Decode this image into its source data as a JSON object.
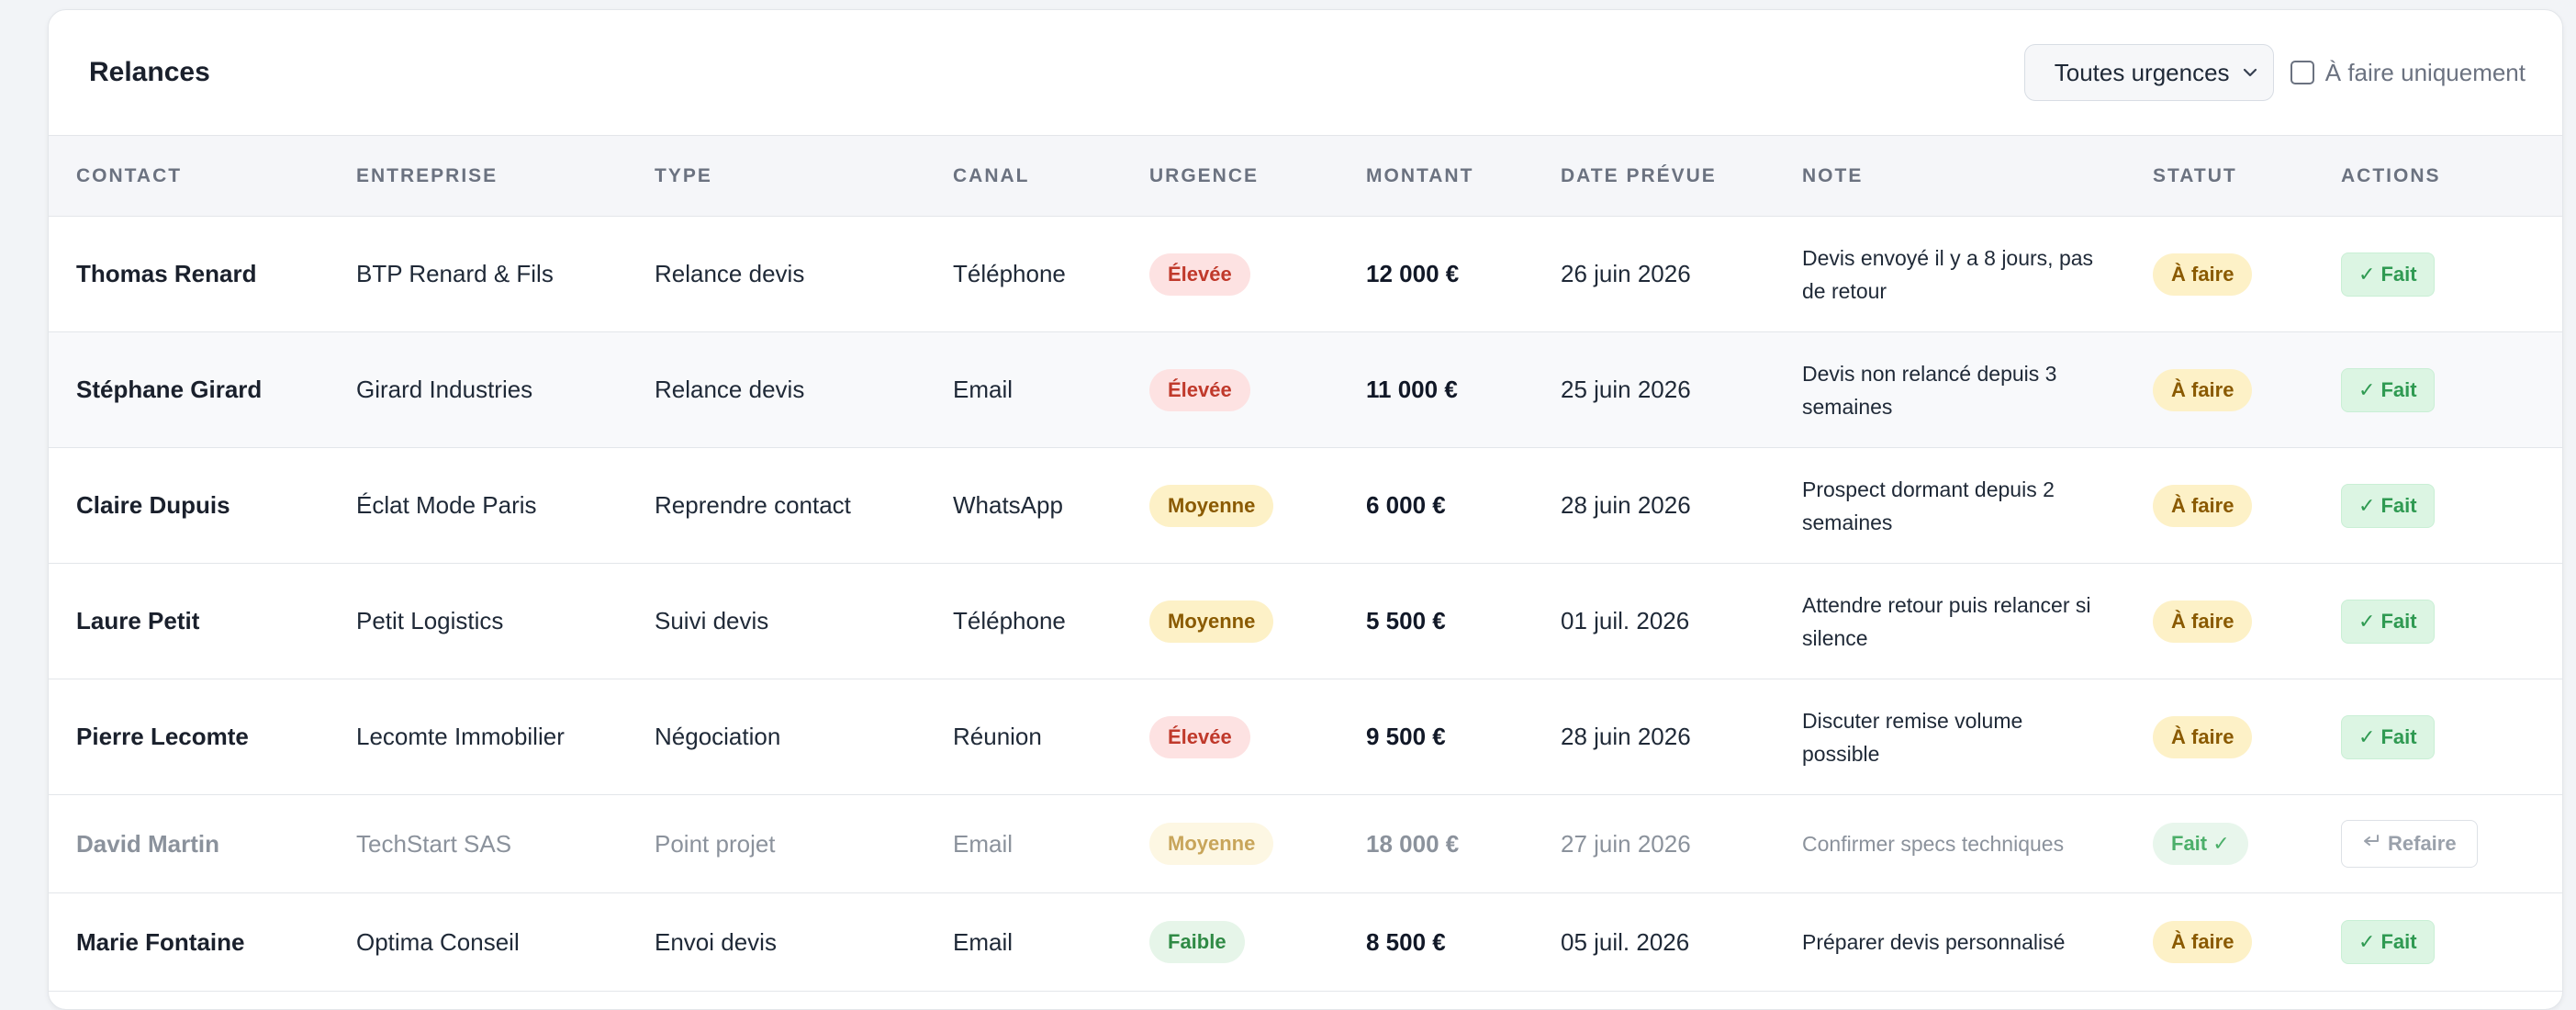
{
  "header": {
    "title": "Relances",
    "urgency_filter": "Toutes urgences",
    "todo_only_label": "À faire uniquement"
  },
  "columns": [
    "Contact",
    "Entreprise",
    "Type",
    "Canal",
    "Urgence",
    "Montant",
    "Date prévue",
    "Note",
    "Statut",
    "Actions"
  ],
  "rows": [
    {
      "contact": "Thomas Renard",
      "company": "BTP Renard & Fils",
      "type": "Relance devis",
      "channel": "Téléphone",
      "urgency": "Élevée",
      "amount": "12 000 €",
      "date": "26 juin 2026",
      "note": "Devis envoyé il y a 8 jours, pas de retour",
      "status": "À faire",
      "action": "Fait"
    },
    {
      "contact": "Stéphane Girard",
      "company": "Girard Industries",
      "type": "Relance devis",
      "channel": "Email",
      "urgency": "Élevée",
      "amount": "11 000 €",
      "date": "25 juin 2026",
      "note": "Devis non relancé depuis 3 semaines",
      "status": "À faire",
      "action": "Fait"
    },
    {
      "contact": "Claire Dupuis",
      "company": "Éclat Mode Paris",
      "type": "Reprendre contact",
      "channel": "WhatsApp",
      "urgency": "Moyenne",
      "amount": "6 000 €",
      "date": "28 juin 2026",
      "note": "Prospect dormant depuis 2 semaines",
      "status": "À faire",
      "action": "Fait"
    },
    {
      "contact": "Laure Petit",
      "company": "Petit Logistics",
      "type": "Suivi devis",
      "channel": "Téléphone",
      "urgency": "Moyenne",
      "amount": "5 500 €",
      "date": "01 juil. 2026",
      "note": "Attendre retour puis relancer si silence",
      "status": "À faire",
      "action": "Fait"
    },
    {
      "contact": "Pierre Lecomte",
      "company": "Lecomte Immobilier",
      "type": "Négociation",
      "channel": "Réunion",
      "urgency": "Élevée",
      "amount": "9 500 €",
      "date": "28 juin 2026",
      "note": "Discuter remise volume possible",
      "status": "À faire",
      "action": "Fait"
    },
    {
      "contact": "David Martin",
      "company": "TechStart SAS",
      "type": "Point projet",
      "channel": "Email",
      "urgency": "Moyenne",
      "amount": "18 000 €",
      "date": "27 juin 2026",
      "note": "Confirmer specs techniques",
      "status": "Fait ✓",
      "action": "Refaire"
    },
    {
      "contact": "Marie Fontaine",
      "company": "Optima Conseil",
      "type": "Envoi devis",
      "channel": "Email",
      "urgency": "Faible",
      "amount": "8 500 €",
      "date": "05 juil. 2026",
      "note": "Préparer devis personnalisé",
      "status": "À faire",
      "action": "Fait"
    }
  ],
  "colors": {
    "high": "#c0392b",
    "medium": "#8a5a00",
    "low": "#2f8a45",
    "done_action": "#2f9a52"
  },
  "icons": {
    "check": "check-icon",
    "redo": "redo-arrow-icon",
    "dropdown": "chevron-down-icon"
  }
}
